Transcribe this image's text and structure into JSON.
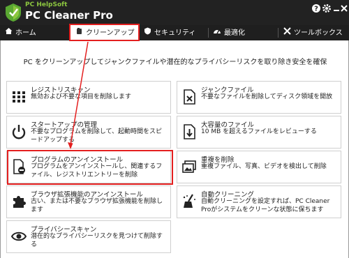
{
  "titlebar": {
    "brand_small": "PC HelpSoft",
    "brand_big": "PC Cleaner Pro",
    "controls": [
      "help-icon",
      "gear-icon",
      "minimize-icon",
      "close-icon"
    ]
  },
  "tabs": [
    {
      "label": "ホーム",
      "icon": "home-icon"
    },
    {
      "label": "クリーンアップ",
      "icon": "broom-icon"
    },
    {
      "label": "セキュリティ",
      "icon": "shield-icon"
    },
    {
      "label": "最適化",
      "icon": "speedometer-icon"
    },
    {
      "label": "ツールボックス",
      "icon": "tools-icon"
    }
  ],
  "headline": "PC をクリーンアップしてジャンクファイルや潜在的なプライバシーリスクを取り除き安全を確保",
  "cards": [
    {
      "title": "レジストリスキャン",
      "desc": "無効および不要な項目を削除します",
      "icon": "grid-icon"
    },
    {
      "title": "ジャンクファイル",
      "desc": "不要なファイルを削除してディスク領域を開放",
      "icon": "junk-file-icon"
    },
    {
      "title": "スタートアップの管理",
      "desc": "不要なプログラムを削除して、起動時間をスピードアップする",
      "icon": "power-icon"
    },
    {
      "title": "大容量のファイル",
      "desc": "10 MB を超えるファイルをレビューする",
      "icon": "large-file-icon"
    },
    {
      "title": "プログラムのアンインストール",
      "desc": "プログラムをアンインストールし、関連するファイル、レジストリエントリーを削除",
      "icon": "uninstall-icon"
    },
    {
      "title": "重複を削除",
      "desc": "重複ファイル、写真、ビデオを検出して削除",
      "icon": "duplicate-icon"
    },
    {
      "title": "ブラウザ拡張機能のアンインストール",
      "desc": "古い、または不要なブラウザ拡張機能を削除します",
      "icon": "puzzle-icon"
    },
    {
      "title": "自動クリーニング",
      "desc": "自動クリーニングを設定すれば、PC Cleaner Proがシステムをクリーンな状態に保ちます",
      "icon": "auto-clean-icon"
    },
    {
      "title": "プライバシースキャン",
      "desc": "潜在的なプライバシーリスクを見つけて削除する",
      "icon": "eye-icon"
    }
  ],
  "colors": {
    "highlight": "#e41f1f",
    "brand_green": "#8cc63f",
    "titlebar_bg": "#222222"
  }
}
